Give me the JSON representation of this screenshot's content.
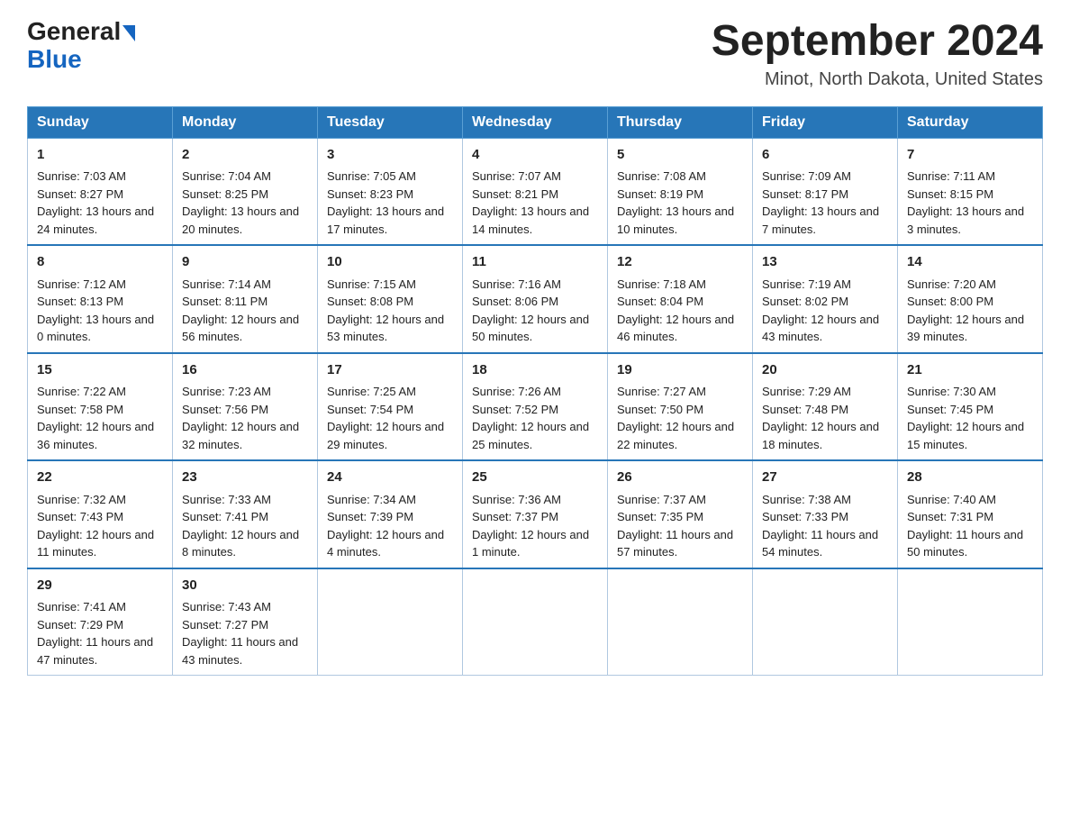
{
  "logo": {
    "text_black": "General",
    "text_blue": "Blue",
    "arrow": true
  },
  "title": "September 2024",
  "subtitle": "Minot, North Dakota, United States",
  "headers": [
    "Sunday",
    "Monday",
    "Tuesday",
    "Wednesday",
    "Thursday",
    "Friday",
    "Saturday"
  ],
  "weeks": [
    [
      {
        "day": "1",
        "sunrise": "7:03 AM",
        "sunset": "8:27 PM",
        "daylight": "13 hours and 24 minutes."
      },
      {
        "day": "2",
        "sunrise": "7:04 AM",
        "sunset": "8:25 PM",
        "daylight": "13 hours and 20 minutes."
      },
      {
        "day": "3",
        "sunrise": "7:05 AM",
        "sunset": "8:23 PM",
        "daylight": "13 hours and 17 minutes."
      },
      {
        "day": "4",
        "sunrise": "7:07 AM",
        "sunset": "8:21 PM",
        "daylight": "13 hours and 14 minutes."
      },
      {
        "day": "5",
        "sunrise": "7:08 AM",
        "sunset": "8:19 PM",
        "daylight": "13 hours and 10 minutes."
      },
      {
        "day": "6",
        "sunrise": "7:09 AM",
        "sunset": "8:17 PM",
        "daylight": "13 hours and 7 minutes."
      },
      {
        "day": "7",
        "sunrise": "7:11 AM",
        "sunset": "8:15 PM",
        "daylight": "13 hours and 3 minutes."
      }
    ],
    [
      {
        "day": "8",
        "sunrise": "7:12 AM",
        "sunset": "8:13 PM",
        "daylight": "13 hours and 0 minutes."
      },
      {
        "day": "9",
        "sunrise": "7:14 AM",
        "sunset": "8:11 PM",
        "daylight": "12 hours and 56 minutes."
      },
      {
        "day": "10",
        "sunrise": "7:15 AM",
        "sunset": "8:08 PM",
        "daylight": "12 hours and 53 minutes."
      },
      {
        "day": "11",
        "sunrise": "7:16 AM",
        "sunset": "8:06 PM",
        "daylight": "12 hours and 50 minutes."
      },
      {
        "day": "12",
        "sunrise": "7:18 AM",
        "sunset": "8:04 PM",
        "daylight": "12 hours and 46 minutes."
      },
      {
        "day": "13",
        "sunrise": "7:19 AM",
        "sunset": "8:02 PM",
        "daylight": "12 hours and 43 minutes."
      },
      {
        "day": "14",
        "sunrise": "7:20 AM",
        "sunset": "8:00 PM",
        "daylight": "12 hours and 39 minutes."
      }
    ],
    [
      {
        "day": "15",
        "sunrise": "7:22 AM",
        "sunset": "7:58 PM",
        "daylight": "12 hours and 36 minutes."
      },
      {
        "day": "16",
        "sunrise": "7:23 AM",
        "sunset": "7:56 PM",
        "daylight": "12 hours and 32 minutes."
      },
      {
        "day": "17",
        "sunrise": "7:25 AM",
        "sunset": "7:54 PM",
        "daylight": "12 hours and 29 minutes."
      },
      {
        "day": "18",
        "sunrise": "7:26 AM",
        "sunset": "7:52 PM",
        "daylight": "12 hours and 25 minutes."
      },
      {
        "day": "19",
        "sunrise": "7:27 AM",
        "sunset": "7:50 PM",
        "daylight": "12 hours and 22 minutes."
      },
      {
        "day": "20",
        "sunrise": "7:29 AM",
        "sunset": "7:48 PM",
        "daylight": "12 hours and 18 minutes."
      },
      {
        "day": "21",
        "sunrise": "7:30 AM",
        "sunset": "7:45 PM",
        "daylight": "12 hours and 15 minutes."
      }
    ],
    [
      {
        "day": "22",
        "sunrise": "7:32 AM",
        "sunset": "7:43 PM",
        "daylight": "12 hours and 11 minutes."
      },
      {
        "day": "23",
        "sunrise": "7:33 AM",
        "sunset": "7:41 PM",
        "daylight": "12 hours and 8 minutes."
      },
      {
        "day": "24",
        "sunrise": "7:34 AM",
        "sunset": "7:39 PM",
        "daylight": "12 hours and 4 minutes."
      },
      {
        "day": "25",
        "sunrise": "7:36 AM",
        "sunset": "7:37 PM",
        "daylight": "12 hours and 1 minute."
      },
      {
        "day": "26",
        "sunrise": "7:37 AM",
        "sunset": "7:35 PM",
        "daylight": "11 hours and 57 minutes."
      },
      {
        "day": "27",
        "sunrise": "7:38 AM",
        "sunset": "7:33 PM",
        "daylight": "11 hours and 54 minutes."
      },
      {
        "day": "28",
        "sunrise": "7:40 AM",
        "sunset": "7:31 PM",
        "daylight": "11 hours and 50 minutes."
      }
    ],
    [
      {
        "day": "29",
        "sunrise": "7:41 AM",
        "sunset": "7:29 PM",
        "daylight": "11 hours and 47 minutes."
      },
      {
        "day": "30",
        "sunrise": "7:43 AM",
        "sunset": "7:27 PM",
        "daylight": "11 hours and 43 minutes."
      },
      null,
      null,
      null,
      null,
      null
    ]
  ],
  "labels": {
    "sunrise": "Sunrise:",
    "sunset": "Sunset:",
    "daylight": "Daylight:"
  }
}
